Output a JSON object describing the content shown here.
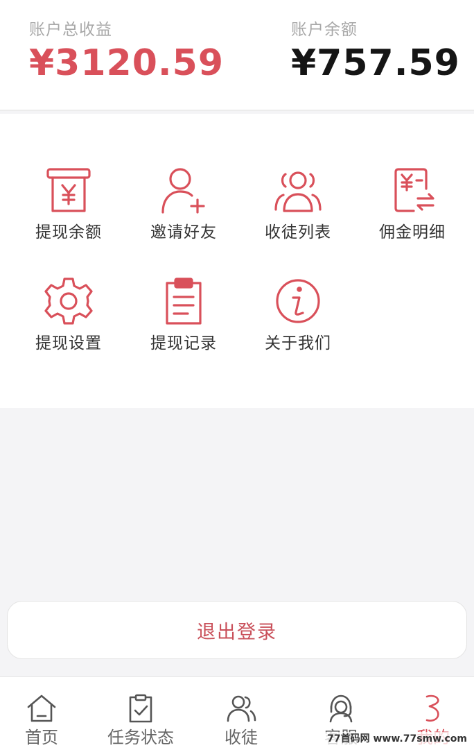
{
  "summary": {
    "total_label": "账户总收益",
    "total_value": "¥3120.59",
    "balance_label": "账户余额",
    "balance_value": "¥757.59"
  },
  "menu": {
    "items": [
      {
        "label": "提现余额",
        "icon": "withdraw-balance-icon"
      },
      {
        "label": "邀请好友",
        "icon": "invite-friend-icon"
      },
      {
        "label": "收徒列表",
        "icon": "apprentice-list-icon"
      },
      {
        "label": "佣金明细",
        "icon": "commission-detail-icon"
      },
      {
        "label": "提现设置",
        "icon": "gear-icon"
      },
      {
        "label": "提现记录",
        "icon": "clipboard-icon"
      },
      {
        "label": "关于我们",
        "icon": "info-icon"
      }
    ]
  },
  "logout": {
    "label": "退出登录"
  },
  "tabbar": {
    "items": [
      {
        "label": "首页",
        "icon": "home-icon"
      },
      {
        "label": "任务状态",
        "icon": "task-status-icon"
      },
      {
        "label": "收徒",
        "icon": "users-icon"
      },
      {
        "label": "客服",
        "icon": "customer-service-icon"
      },
      {
        "label": "我的",
        "icon": "profile-icon",
        "active": true
      }
    ]
  },
  "watermark": "77首码网 www.77smw.com",
  "colors": {
    "accent": "#d9505a",
    "text_dark": "#151515",
    "text_muted": "#a8a8a8",
    "background": "#f4f4f6"
  }
}
